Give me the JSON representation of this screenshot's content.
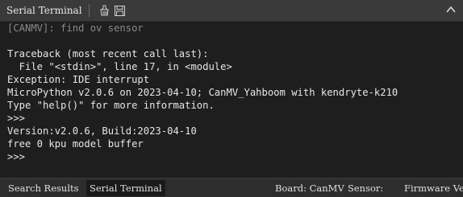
{
  "titlebar": {
    "title": "Serial Terminal",
    "icons": [
      "clear-icon",
      "save-icon",
      "collapse-chevron-icon"
    ]
  },
  "terminal": {
    "lines": [
      {
        "text": "[CANMV]: find ov sensor",
        "dim": true
      },
      {
        "text": "",
        "dim": false
      },
      {
        "text": "Traceback (most recent call last):",
        "dim": false
      },
      {
        "text": "  File \"<stdin>\", line 17, in <module>",
        "dim": false
      },
      {
        "text": "Exception: IDE interrupt",
        "dim": false
      },
      {
        "text": "MicroPython v2.0.6 on 2023-04-10; CanMV_Yahboom with kendryte-k210",
        "dim": false
      },
      {
        "text": "Type \"help()\" for more information.",
        "dim": false
      },
      {
        "text": ">>>",
        "dim": false
      },
      {
        "text": "Version:v2.0.6, Build:2023-04-10",
        "dim": false
      },
      {
        "text": "free 0 kpu model buffer",
        "dim": false
      },
      {
        "text": ">>>",
        "dim": false
      }
    ]
  },
  "statusbar": {
    "tabs": [
      {
        "label": "Search Results",
        "active": false
      },
      {
        "label": "Serial Terminal",
        "active": true
      }
    ],
    "board": "Board: CanMV",
    "sensor": "Sensor:",
    "firmware": "Firmware Ver"
  },
  "colors": {
    "background": "#1e1e1e",
    "titlebar": "#3a3a3a",
    "text": "#e6e6e6",
    "dim_text": "#8a8a8a"
  }
}
